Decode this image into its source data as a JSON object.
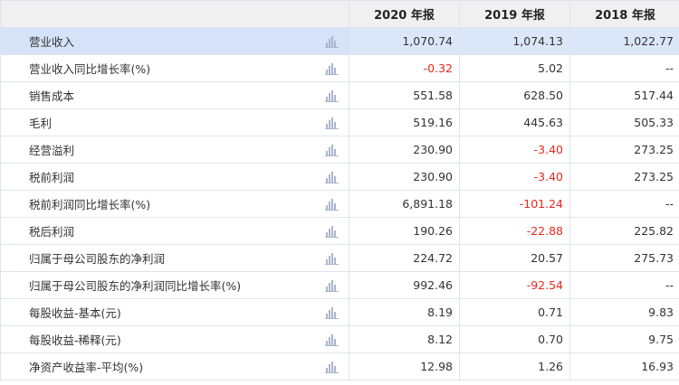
{
  "columns": [
    "2020 年报",
    "2019 年报",
    "2018 年报"
  ],
  "rows": [
    {
      "label": "营业收入",
      "values": [
        "1,070.74",
        "1,074.13",
        "1,022.77"
      ],
      "highlight": true
    },
    {
      "label": "营业收入同比增长率(%)",
      "values": [
        "-0.32",
        "5.02",
        "--"
      ]
    },
    {
      "label": "销售成本",
      "values": [
        "551.58",
        "628.50",
        "517.44"
      ]
    },
    {
      "label": "毛利",
      "values": [
        "519.16",
        "445.63",
        "505.33"
      ]
    },
    {
      "label": "经营溢利",
      "values": [
        "230.90",
        "-3.40",
        "273.25"
      ]
    },
    {
      "label": "税前利润",
      "values": [
        "230.90",
        "-3.40",
        "273.25"
      ]
    },
    {
      "label": "税前利润同比增长率(%)",
      "values": [
        "6,891.18",
        "-101.24",
        "--"
      ]
    },
    {
      "label": "税后利润",
      "values": [
        "190.26",
        "-22.88",
        "225.82"
      ]
    },
    {
      "label": "归属于母公司股东的净利润",
      "values": [
        "224.72",
        "20.57",
        "275.73"
      ]
    },
    {
      "label": "归属于母公司股东的净利润同比增长率(%)",
      "values": [
        "992.46",
        "-92.54",
        "--"
      ]
    },
    {
      "label": "每股收益-基本(元)",
      "values": [
        "8.19",
        "0.71",
        "9.83"
      ]
    },
    {
      "label": "每股收益-稀释(元)",
      "values": [
        "8.12",
        "0.70",
        "9.75"
      ]
    },
    {
      "label": "净资产收益率-平均(%)",
      "values": [
        "12.98",
        "1.26",
        "16.93"
      ]
    }
  ],
  "icons": {
    "row_chart": "bar-chart-icon"
  },
  "colors": {
    "negative": "#e8281f",
    "highlight_row": "#dbe6f9",
    "header_bg": "#f0f0f0"
  }
}
